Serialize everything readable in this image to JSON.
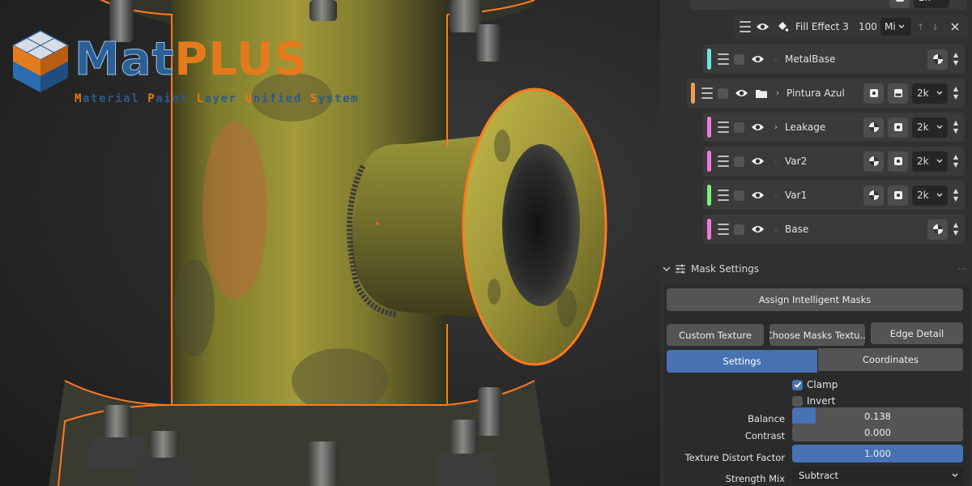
{
  "logo": {
    "title_part1": "Mat",
    "title_part2": "PLUS",
    "subtitle_segments": [
      {
        "text": "M",
        "accent": true
      },
      {
        "text": "aterial ",
        "accent": false
      },
      {
        "text": "P",
        "accent": true
      },
      {
        "text": "aint ",
        "accent": false
      },
      {
        "text": "L",
        "accent": true
      },
      {
        "text": "ayer ",
        "accent": false
      },
      {
        "text": "U",
        "accent": true
      },
      {
        "text": "nified ",
        "accent": false
      },
      {
        "text": "S",
        "accent": true
      },
      {
        "text": "ystem",
        "accent": false
      }
    ]
  },
  "layers": {
    "fill_effect": {
      "name": "Fill Effect 3",
      "opacity": "100",
      "blend": "Mi"
    },
    "items": [
      {
        "name": "MetalBase",
        "color": "#6fe3e0",
        "expandable": false,
        "folder": false,
        "resolution": ""
      },
      {
        "name": "Pintura Azul",
        "color": "#f0a050",
        "expandable": true,
        "folder": true,
        "resolution": "2k"
      },
      {
        "name": "Leakage",
        "color": "#f07ad8",
        "expandable": true,
        "folder": false,
        "resolution": "2k"
      },
      {
        "name": "Var2",
        "color": "#f07ad8",
        "expandable": false,
        "folder": false,
        "resolution": "2k"
      },
      {
        "name": "Var1",
        "color": "#7ef07a",
        "expandable": false,
        "folder": false,
        "resolution": "2k"
      },
      {
        "name": "Base",
        "color": "#f07ad8",
        "expandable": false,
        "folder": false,
        "resolution": ""
      }
    ],
    "top_partial_resolution": "2k"
  },
  "mask_settings": {
    "title": "Mask Settings",
    "assign_button": "Assign Intelligent Masks",
    "custom_texture_button": "Custom Texture",
    "choose_masks_button": "Choose Masks Textu...",
    "edge_detail_button": "Edge Detail",
    "tabs": [
      {
        "label": "Settings",
        "active": true
      },
      {
        "label": "Coordinates",
        "active": false
      }
    ],
    "clamp": {
      "label": "Clamp",
      "checked": true
    },
    "invert": {
      "label": "Invert",
      "checked": false
    },
    "balance": {
      "label": "Balance",
      "value": "0.138",
      "fraction": 0.138
    },
    "contrast": {
      "label": "Contrast",
      "value": "0.000",
      "fraction": 0.0
    },
    "distort": {
      "label": "Texture Distort Factor",
      "value": "1.000",
      "fraction": 1.0
    },
    "strength_mix": {
      "label": "Strength Mix",
      "value": "Subtract"
    }
  },
  "colors": {
    "accent_blue": "#4772b3",
    "selection_orange": "#ff7a1e",
    "pipe_yellow": "#8c8a2a"
  }
}
